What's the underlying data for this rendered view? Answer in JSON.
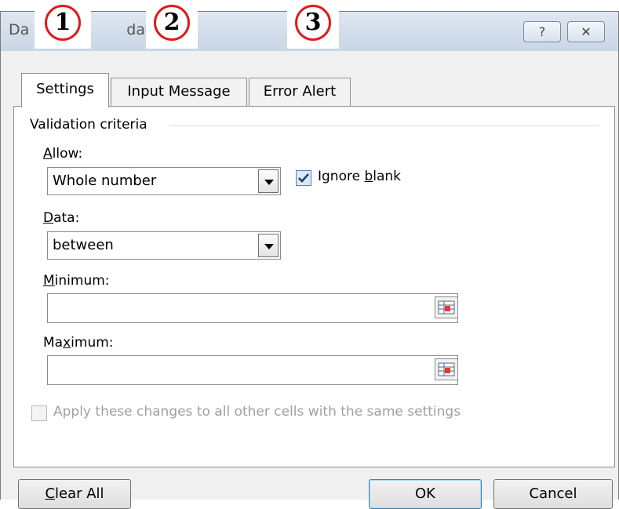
{
  "dialog": {
    "title_left": "Da",
    "title_right": "dation",
    "help_glyph": "?",
    "close_glyph": "✕"
  },
  "badges": [
    "1",
    "2",
    "3"
  ],
  "tabs": [
    {
      "label": "Settings",
      "active": true
    },
    {
      "label": "Input Message",
      "active": false
    },
    {
      "label": "Error Alert",
      "active": false
    }
  ],
  "settings": {
    "group_label": "Validation criteria",
    "allow_label_pre": "",
    "allow_label_ul": "A",
    "allow_label_post": "llow:",
    "allow_value": "Whole number",
    "ignore_blank_pre": "Ignore ",
    "ignore_blank_ul": "b",
    "ignore_blank_post": "lank",
    "ignore_blank_checked": true,
    "data_label_ul": "D",
    "data_label_post": "ata:",
    "data_value": "between",
    "minimum_label_ul": "M",
    "minimum_label_post": "inimum:",
    "minimum_value": "",
    "maximum_label_pre": "Ma",
    "maximum_label_ul": "x",
    "maximum_label_post": "imum:",
    "maximum_value": "",
    "apply_all_label": "Apply these changes to all other cells with the same settings",
    "apply_all_checked": false
  },
  "buttons": {
    "clear_all_ul": "C",
    "clear_all_post": "lear All",
    "ok": "OK",
    "cancel": "Cancel"
  },
  "icons": {
    "help": "help-icon",
    "close": "close-icon",
    "dropdown": "dropdown-arrow-icon",
    "range_select": "range-select-icon",
    "check": "checkmark-icon"
  },
  "colors": {
    "badge_ring": "#e01b1b",
    "checkbox_border": "#7f9db9",
    "default_button_border": "#3c7fb1"
  }
}
